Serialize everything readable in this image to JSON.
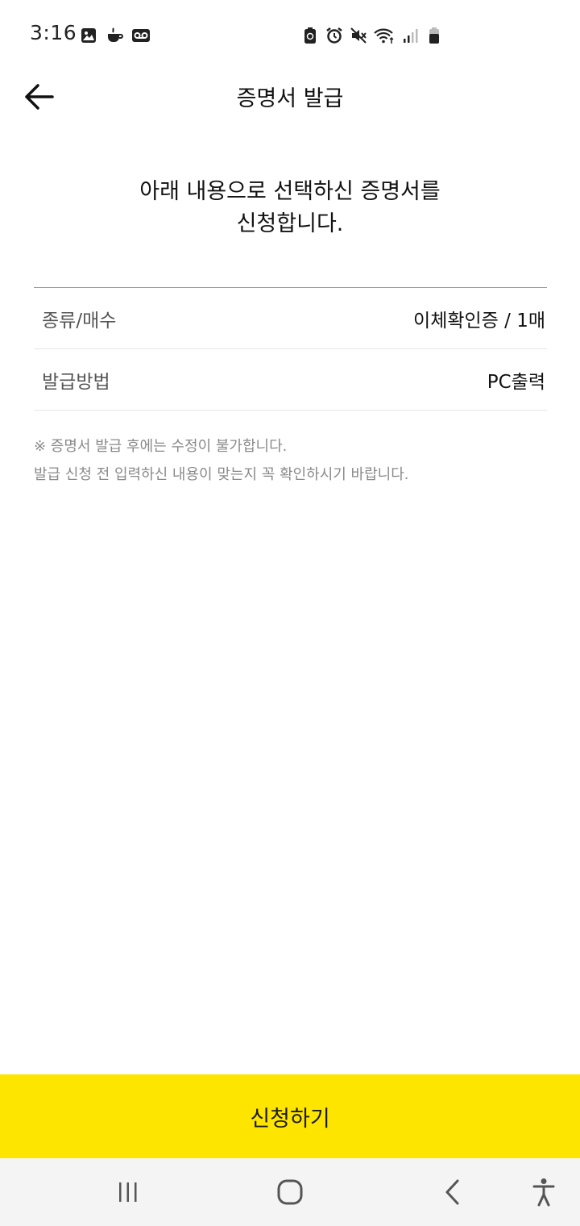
{
  "status_bar": {
    "time": "3:16",
    "left_icons": [
      "gallery-icon",
      "coffee-icon",
      "voicemail-icon"
    ],
    "right_icons": [
      "battery-saver-icon",
      "alarm-icon",
      "mute-icon",
      "wifi-icon",
      "signal-icon",
      "battery-icon"
    ]
  },
  "header": {
    "title": "증명서 발급"
  },
  "intro": {
    "line1": "아래 내용으로 선택하신 증명서를",
    "line2": "신청합니다."
  },
  "details": [
    {
      "label": "종류/매수",
      "value": "이체확인증 / 1매"
    },
    {
      "label": "발급방법",
      "value": "PC출력"
    }
  ],
  "notice": {
    "line1": "※ 증명서 발급 후에는 수정이 불가합니다.",
    "line2": "발급 신청 전 입력하신 내용이 맞는지 꼭 확인하시기 바랍니다."
  },
  "apply_button": {
    "label": "신청하기"
  },
  "colors": {
    "accent": "#fee500",
    "nav_background": "#f4f4f4"
  }
}
